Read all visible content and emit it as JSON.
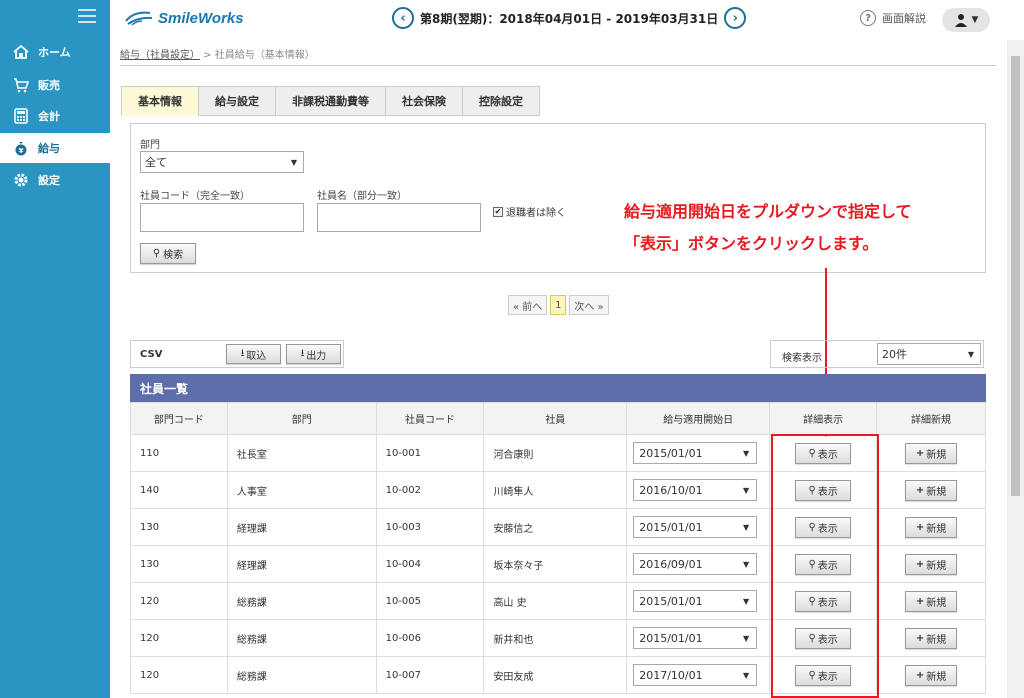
{
  "header": {
    "logo_text": "SmileWorks",
    "period_text": "第8期(翌期)：2018年04月01日 - 2019年03月31日",
    "help_label": "画面解説"
  },
  "sidebar": {
    "items": [
      {
        "label": "ホーム",
        "icon": "home-icon"
      },
      {
        "label": "販売",
        "icon": "cart-icon"
      },
      {
        "label": "会計",
        "icon": "calculator-icon"
      },
      {
        "label": "給与",
        "icon": "money-bag-icon",
        "active": true
      },
      {
        "label": "設定",
        "icon": "gear-icon"
      }
    ]
  },
  "breadcrumb": {
    "link": "給与（社員設定）",
    "sep": " > ",
    "current": "社員給与（基本情報）"
  },
  "tabs": [
    "基本情報",
    "給与設定",
    "非課税通勤費等",
    "社会保険",
    "控除設定"
  ],
  "search": {
    "dept_label": "部門",
    "dept_value": "全て",
    "emp_code_label": "社員コード（完全一致）",
    "emp_name_label": "社員名（部分一致）",
    "exclude_retired_label": "退職者は除く",
    "search_button": "検索"
  },
  "annotation": {
    "line1": "給与適用開始日をプルダウンで指定して",
    "line2": "「表示」ボタンをクリックします。"
  },
  "pager": {
    "prev": "« 前へ",
    "current": "1",
    "next": "次へ »"
  },
  "csv": {
    "label": "CSV",
    "import_button": "取込",
    "export_button": "出力"
  },
  "display": {
    "label": "検索表示",
    "value": "20件"
  },
  "grid": {
    "title": "社員一覧",
    "columns": [
      "部門コード",
      "部門",
      "社員コード",
      "社員",
      "給与適用開始日",
      "詳細表示",
      "詳細新規"
    ],
    "view_button": "表示",
    "new_button": "新規",
    "rows": [
      {
        "dept_code": "110",
        "dept": "社長室",
        "emp_code": "10-001",
        "name": "河合康則",
        "date": "2015/01/01"
      },
      {
        "dept_code": "140",
        "dept": "人事室",
        "emp_code": "10-002",
        "name": "川崎隼人",
        "date": "2016/10/01"
      },
      {
        "dept_code": "130",
        "dept": "経理課",
        "emp_code": "10-003",
        "name": "安藤信之",
        "date": "2015/01/01"
      },
      {
        "dept_code": "130",
        "dept": "経理課",
        "emp_code": "10-004",
        "name": "坂本奈々子",
        "date": "2016/09/01"
      },
      {
        "dept_code": "120",
        "dept": "総務課",
        "emp_code": "10-005",
        "name": "高山 史",
        "date": "2015/01/01"
      },
      {
        "dept_code": "120",
        "dept": "総務課",
        "emp_code": "10-006",
        "name": "新井和也",
        "date": "2015/01/01"
      },
      {
        "dept_code": "120",
        "dept": "総務課",
        "emp_code": "10-007",
        "name": "安田友成",
        "date": "2017/10/01"
      }
    ]
  },
  "colors": {
    "sidebar": "#2a95c3",
    "grid_header": "#5c6fab",
    "annotation": "#e8191f"
  }
}
